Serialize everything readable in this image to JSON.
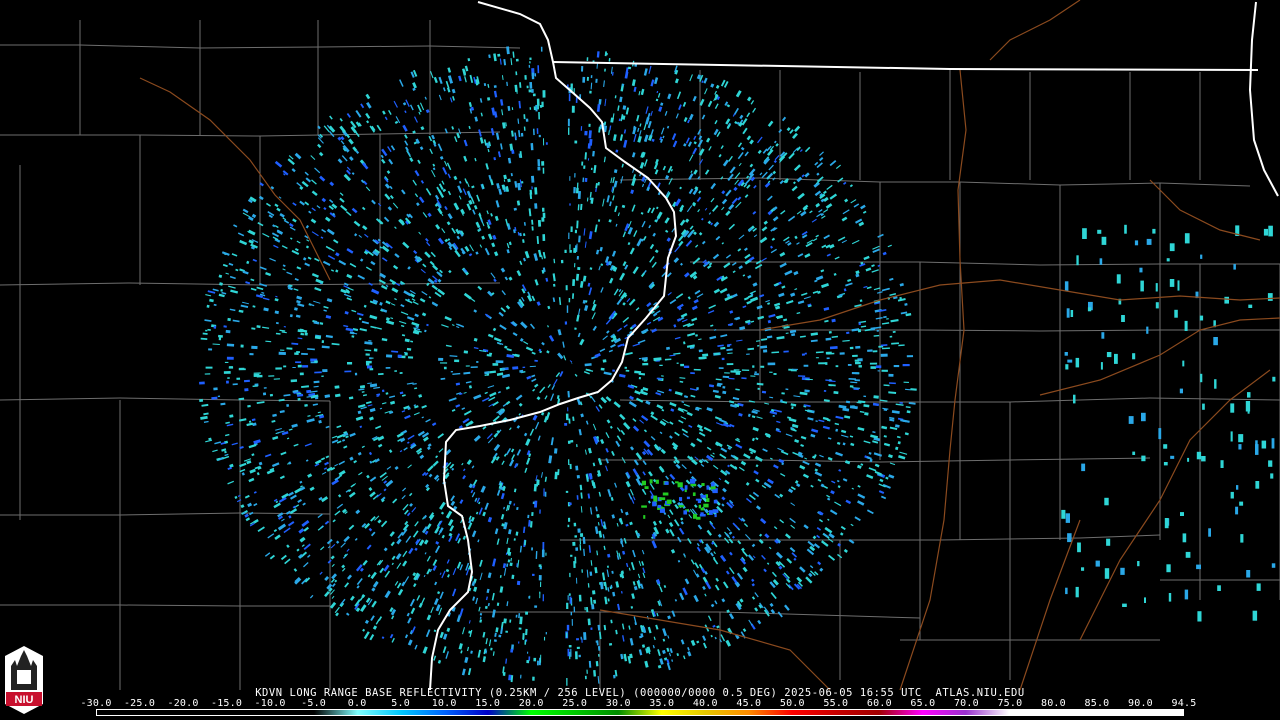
{
  "product": {
    "station": "KDVN",
    "caption": "KDVN LONG RANGE BASE REFLECTIVITY (0.25KM / 256 LEVEL) (000000/0000 0.5 DEG) 2025-06-05 16:55 UTC  ATLAS.NIU.EDU"
  },
  "logo": {
    "text": "NIU"
  },
  "colorbar": {
    "tick_labels": [
      "-30.0",
      "-25.0",
      "-20.0",
      "-15.0",
      "-10.0",
      "-5.0",
      "0.0",
      "5.0",
      "10.0",
      "15.0",
      "20.0",
      "25.0",
      "30.0",
      "35.0",
      "40.0",
      "45.0",
      "50.0",
      "55.0",
      "60.0",
      "65.0",
      "70.0",
      "75.0",
      "80.0",
      "85.0",
      "90.0",
      "94.5"
    ],
    "gradient_colors": [
      "#000000",
      "#000000",
      "#000000",
      "#000000",
      "#000000",
      "#000000",
      "#7fffff",
      "#00c8ff",
      "#0064ff",
      "#0000c8",
      "#00ff00",
      "#00c800",
      "#008c00",
      "#ffff00",
      "#e6c800",
      "#ff8c00",
      "#ff0000",
      "#c80000",
      "#a00000",
      "#ff00ff",
      "#9932cc",
      "#ffffff",
      "#ffffff",
      "#ffffff",
      "#ffffff",
      "#ffffff"
    ]
  },
  "map_colors": {
    "background": "#000000",
    "county_lines": "#6e6e6e",
    "state_lines": "#ffffff",
    "highways": "#8b4a1e",
    "echo_light": "#2fd6d6",
    "echo_mid": "#2aa8e8",
    "echo_blue": "#1f5fff",
    "echo_green": "#22cc22"
  }
}
